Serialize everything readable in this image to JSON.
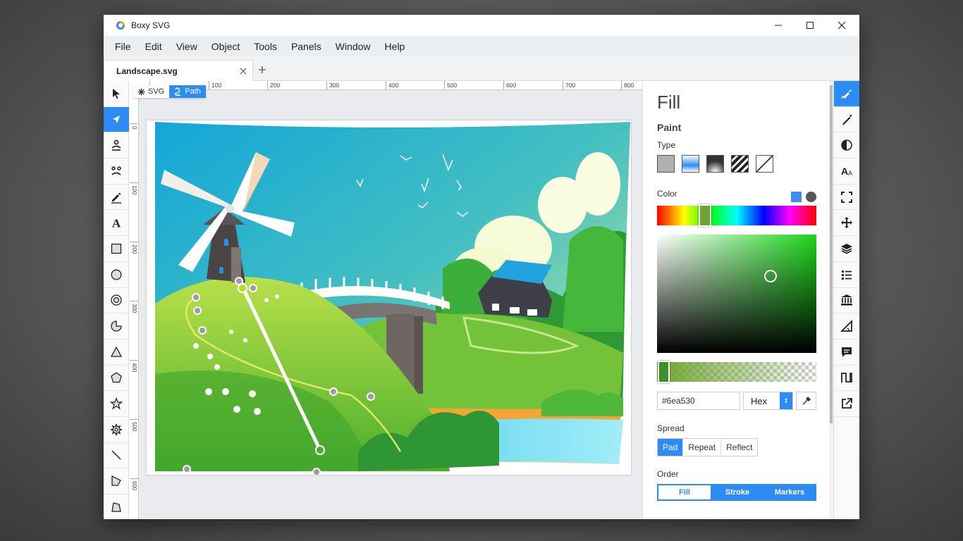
{
  "window": {
    "title": "Boxy SVG",
    "controls": [
      "minimize",
      "maximize",
      "close"
    ]
  },
  "menu": [
    "File",
    "Edit",
    "View",
    "Object",
    "Tools",
    "Panels",
    "Window",
    "Help"
  ],
  "tab": {
    "label": "Landscape.svg",
    "close_icon": "close-icon",
    "new_tab_icon": "plus-icon"
  },
  "tools": [
    "pointer-icon",
    "path-edit-icon",
    "person-icon",
    "face-icon",
    "pencil-icon",
    "text-icon",
    "rectangle-icon",
    "ellipse-icon",
    "ring-icon",
    "pie-icon",
    "triangle-icon",
    "pentagon-icon",
    "star-icon",
    "gear-icon",
    "line-icon",
    "polygon-icon",
    "polygon-alt-icon"
  ],
  "active_tool": "path-edit-icon",
  "ruler": {
    "h": [
      "",
      "100",
      "200",
      "300",
      "400",
      "500",
      "600",
      "700",
      "800"
    ],
    "v": [
      "0",
      "100",
      "200",
      "300",
      "400",
      "500",
      "600"
    ]
  },
  "breadcrumbs": [
    {
      "label": "SVG",
      "icon": "asterisk-icon"
    },
    {
      "label": "Path",
      "icon": "path-icon"
    }
  ],
  "panel": {
    "title": "Fill",
    "paint_label": "Paint",
    "type_label": "Type",
    "types": [
      "flat",
      "linear-gradient",
      "radial-gradient",
      "pattern",
      "none"
    ],
    "color_label": "Color",
    "hue_fraction": 0.26,
    "saturation": 0.71,
    "value": 0.65,
    "alpha": 1.0,
    "hex_value": "#6ea530",
    "format": "Hex",
    "spread_label": "Spread",
    "spread": [
      "Pad",
      "Repeat",
      "Reflect"
    ],
    "spread_active": "Pad",
    "order_label": "Order",
    "order": [
      "Fill",
      "Stroke",
      "Markers"
    ],
    "order_active": "Fill",
    "colors": {
      "accent": "#2c8cf4",
      "current": "#6ea530"
    }
  },
  "right_tools": [
    "fill-icon",
    "stroke-icon",
    "contrast-icon",
    "typography-icon",
    "fullscreen-icon",
    "move-icon",
    "layers-icon",
    "list-icon",
    "library-icon",
    "geometry-icon",
    "comment-icon",
    "waveform-icon",
    "export-icon"
  ],
  "active_right_tool": "fill-icon"
}
